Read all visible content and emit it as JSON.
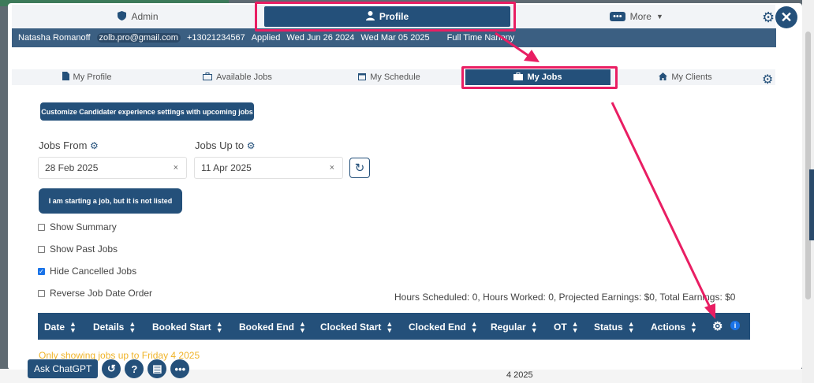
{
  "top_nav": {
    "admin_label": "Admin",
    "profile_label": "Profile",
    "more_label": "More"
  },
  "info_bar": {
    "name": "Natasha Romanoff",
    "email": "zolb.pro@gmail.com",
    "phone": "+13021234567",
    "applied_label": "Applied",
    "applied_date": "Wed Jun 26 2024",
    "second_date": "Wed Mar 05 2025",
    "role": "Full Time Nannny"
  },
  "sub_nav": {
    "my_profile": "My Profile",
    "available_jobs": "Available Jobs",
    "my_schedule": "My Schedule",
    "my_jobs": "My Jobs",
    "my_clients": "My Clients"
  },
  "buttons": {
    "customize": "Customize Candidater experience settings with upcoming jobs",
    "starting_job": "I am starting a job, but it is not listed"
  },
  "filters": {
    "jobs_from_label": "Jobs From",
    "jobs_from_value": "28 Feb 2025",
    "jobs_up_to_label": "Jobs Up to",
    "jobs_up_to_value": "11 Apr 2025",
    "clear_symbol": "×"
  },
  "checkboxes": {
    "show_summary": "Show Summary",
    "show_past_jobs": "Show Past Jobs",
    "hide_cancelled_jobs": "Hide Cancelled Jobs",
    "reverse_order": "Reverse Job Date Order"
  },
  "summary_text": "Hours Scheduled: 0, Hours Worked: 0, Projected Earnings: $0, Total Earnings: $0",
  "table": {
    "columns": [
      "Date",
      "Details",
      "Booked Start",
      "Booked End",
      "Clocked Start",
      "Clocked End",
      "Regular",
      "OT",
      "Status",
      "Actions"
    ]
  },
  "faded_notice": "Only showing jobs up to Friday 4 2025",
  "bottom_bar": {
    "ask_label": "Ask ChatGPT"
  },
  "background_text": "4 2025",
  "colors": {
    "primary": "#24507a",
    "highlight": "#e91e63",
    "info_bar": "#3b5f82"
  }
}
